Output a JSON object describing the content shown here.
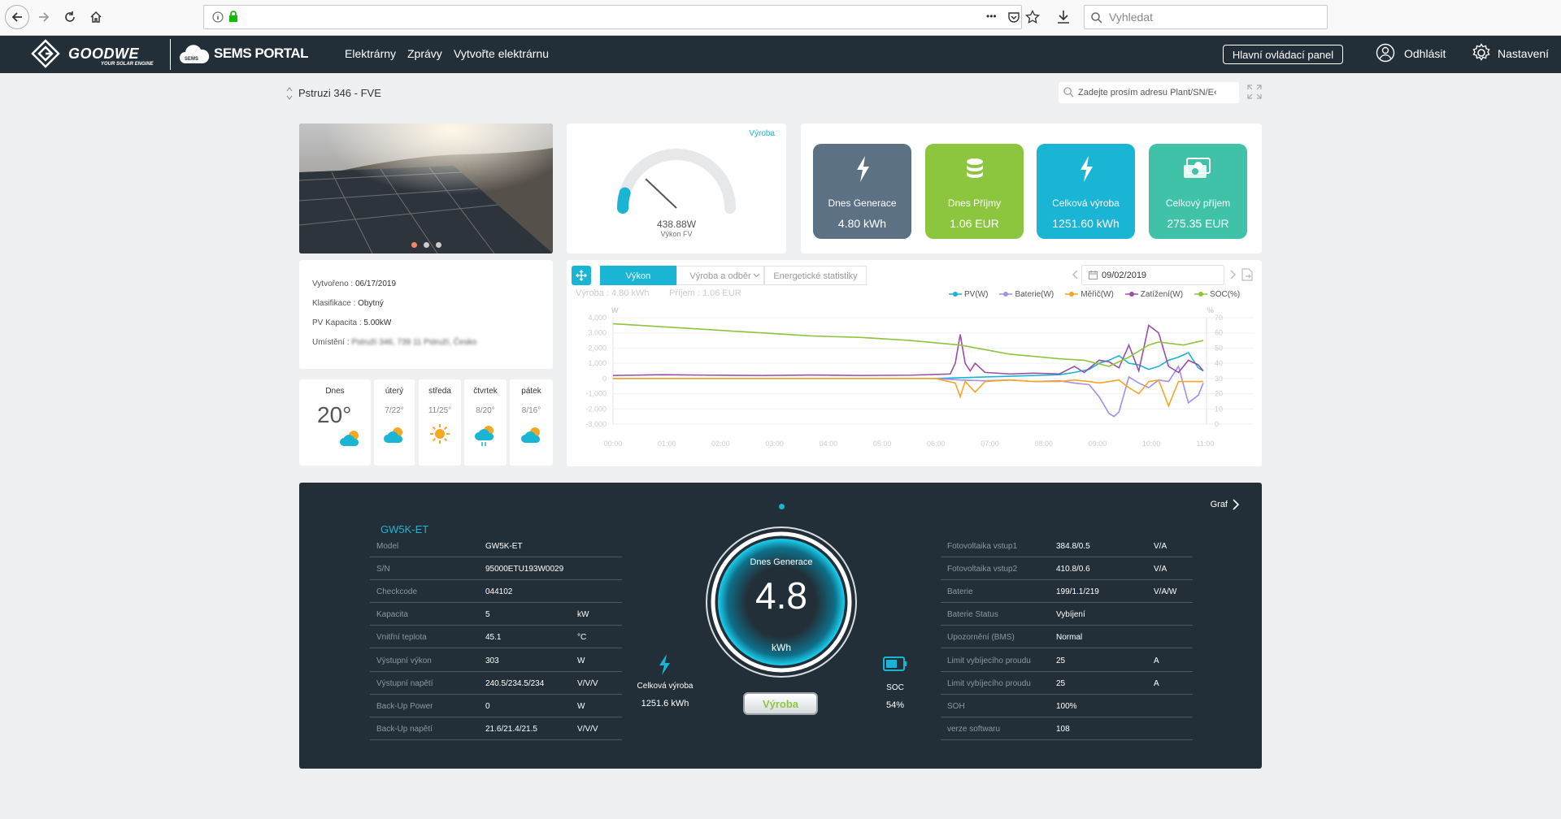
{
  "browser": {
    "search_placeholder": "Vyhledat",
    "menu_dots": "•••"
  },
  "nav": {
    "logo_main": "GOODWE",
    "logo_tagline": "YOUR SOLAR ENGINE",
    "portal_badge": "SEMS",
    "portal_name": "SEMS PORTAL",
    "links": [
      "Elektrárny",
      "Zprávy",
      "Vytvořte elektrárnu"
    ],
    "dashboard_button": "Hlavní ovládací panel",
    "logout": "Odhlásit",
    "settings": "Nastavení"
  },
  "page": {
    "plant_name": "Pstruzi 346 - FVE",
    "search_placeholder": "Zadejte prosím adresu Plant/SN/E‹"
  },
  "gauge": {
    "tag": "Výroba",
    "value": "438.88W",
    "label": "Výkon FV",
    "fraction": 0.09
  },
  "tiles": [
    {
      "label": "Dnes Generace",
      "value": "4.80 kWh",
      "color": "#5c7184",
      "icon": "lightning-icon"
    },
    {
      "label": "Dnes Příjmy",
      "value": "1.06 EUR",
      "color": "#8cc63f",
      "icon": "coins-icon"
    },
    {
      "label": "Celková výroba",
      "value": "1251.60 kWh",
      "color": "#1ab4d4",
      "icon": "lightning-icon"
    },
    {
      "label": "Celkový příjem",
      "value": "275.35 EUR",
      "color": "#3fc2a8",
      "icon": "money-icon"
    }
  ],
  "plant_info": [
    {
      "key": "Vytvořeno : ",
      "value": "06/17/2019"
    },
    {
      "key": "Klasifikace : ",
      "value": "Obytný"
    },
    {
      "key": "PV Kapacita : ",
      "value": "5.00kW"
    },
    {
      "key": "Umístění : ",
      "value": "Pstruží 346, 739 11 Pstruží, Česko"
    }
  ],
  "weather": [
    {
      "day": "Dnes",
      "temp": "20°",
      "icon": "partly-cloudy-icon"
    },
    {
      "day": "úterý",
      "temp": "7/22°",
      "icon": "partly-cloudy-icon"
    },
    {
      "day": "středa",
      "temp": "11/25°",
      "icon": "sun-icon"
    },
    {
      "day": "čtvrtek",
      "temp": "8/20°",
      "icon": "rain-icon"
    },
    {
      "day": "pátek",
      "temp": "8/16°",
      "icon": "partly-cloudy-icon"
    }
  ],
  "chart_tabs": [
    "Výkon",
    "Výroba a odběr",
    "Energetické statistiky"
  ],
  "chart_summary": {
    "production": "Výroba : 4.80 kWh",
    "income": "Příjem : 1.06 EUR"
  },
  "chart_date": "09/02/2019",
  "chart_data": {
    "type": "line",
    "xlabel": "",
    "ylabel": "W",
    "y2label": "%",
    "x": [
      "00:00",
      "01:00",
      "02:00",
      "03:00",
      "04:00",
      "05:00",
      "06:00",
      "07:00",
      "08:00",
      "09:00",
      "10:00",
      "11:00"
    ],
    "ylim": [
      -3000,
      4000
    ],
    "yticks": [
      "4,000",
      "3,000",
      "2,000",
      "1,000",
      "0",
      "-1,000",
      "-2,000",
      "-3,000"
    ],
    "y2lim": [
      0,
      70
    ],
    "y2ticks": [
      "70",
      "60",
      "50",
      "40",
      "30",
      "20",
      "10",
      "0"
    ],
    "legend_position": "top-right",
    "series": [
      {
        "name": "PV(W)",
        "color": "#1ab4d4",
        "axis": "left",
        "points": [
          [
            0,
            0
          ],
          [
            6.5,
            0
          ],
          [
            7,
            50
          ],
          [
            7.5,
            100
          ],
          [
            8,
            150
          ],
          [
            8.5,
            200
          ],
          [
            9,
            250
          ],
          [
            9.3,
            400
          ],
          [
            9.6,
            600
          ],
          [
            9.8,
            1000
          ],
          [
            10,
            1200
          ],
          [
            10.2,
            1500
          ],
          [
            10.4,
            1000
          ],
          [
            10.6,
            900
          ],
          [
            10.8,
            600
          ],
          [
            11,
            800
          ],
          [
            11.2,
            1200
          ],
          [
            11.4,
            1400
          ],
          [
            11.6,
            1700
          ],
          [
            11.8,
            700
          ],
          [
            11.9,
            500
          ]
        ]
      },
      {
        "name": "Baterie(W)",
        "color": "#a58ee8",
        "axis": "left",
        "points": [
          [
            0,
            0
          ],
          [
            6.5,
            0
          ],
          [
            7,
            -100
          ],
          [
            7.5,
            -150
          ],
          [
            8,
            -100
          ],
          [
            8.5,
            -200
          ],
          [
            9,
            -150
          ],
          [
            9.3,
            -300
          ],
          [
            9.6,
            -400
          ],
          [
            9.8,
            -1200
          ],
          [
            10,
            -2300
          ],
          [
            10.1,
            -2500
          ],
          [
            10.2,
            -2200
          ],
          [
            10.4,
            100
          ],
          [
            10.6,
            -300
          ],
          [
            10.8,
            -600
          ],
          [
            11,
            -100
          ],
          [
            11.2,
            -200
          ],
          [
            11.4,
            800
          ],
          [
            11.6,
            -1600
          ],
          [
            11.8,
            -1100
          ],
          [
            11.9,
            -300
          ]
        ]
      },
      {
        "name": "Měřič(W)",
        "color": "#f5a623",
        "axis": "left",
        "points": [
          [
            0,
            0
          ],
          [
            6.5,
            0
          ],
          [
            6.9,
            -300
          ],
          [
            7,
            -1200
          ],
          [
            7.1,
            -200
          ],
          [
            7.3,
            -900
          ],
          [
            7.5,
            -200
          ],
          [
            8,
            -100
          ],
          [
            8.5,
            -200
          ],
          [
            9,
            -200
          ],
          [
            9.3,
            -100
          ],
          [
            9.6,
            -200
          ],
          [
            9.8,
            -300
          ],
          [
            10,
            -200
          ],
          [
            10.2,
            -100
          ],
          [
            10.4,
            -600
          ],
          [
            10.6,
            -1000
          ],
          [
            10.8,
            -200
          ],
          [
            11,
            -100
          ],
          [
            11.2,
            -1800
          ],
          [
            11.4,
            -200
          ],
          [
            11.9,
            -200
          ]
        ]
      },
      {
        "name": "Zatížení(W)",
        "color": "#9a4ea6",
        "axis": "left",
        "points": [
          [
            0,
            200
          ],
          [
            1,
            250
          ],
          [
            2,
            220
          ],
          [
            3,
            200
          ],
          [
            4,
            230
          ],
          [
            5,
            200
          ],
          [
            6,
            220
          ],
          [
            6.8,
            300
          ],
          [
            6.9,
            1000
          ],
          [
            7,
            2900
          ],
          [
            7.1,
            1000
          ],
          [
            7.2,
            500
          ],
          [
            7.3,
            1000
          ],
          [
            7.5,
            400
          ],
          [
            8,
            300
          ],
          [
            8.5,
            350
          ],
          [
            9,
            300
          ],
          [
            9.3,
            800
          ],
          [
            9.5,
            400
          ],
          [
            9.8,
            1200
          ],
          [
            10,
            1100
          ],
          [
            10.2,
            700
          ],
          [
            10.4,
            2200
          ],
          [
            10.6,
            500
          ],
          [
            10.8,
            3500
          ],
          [
            11,
            3000
          ],
          [
            11.2,
            800
          ],
          [
            11.4,
            400
          ],
          [
            11.6,
            1200
          ],
          [
            11.8,
            900
          ],
          [
            11.9,
            500
          ]
        ]
      },
      {
        "name": "SOC(%)",
        "color": "#8cc63f",
        "axis": "right",
        "points": [
          [
            0,
            66
          ],
          [
            1,
            64
          ],
          [
            2,
            62
          ],
          [
            3,
            60
          ],
          [
            4,
            58
          ],
          [
            5,
            57
          ],
          [
            6,
            55
          ],
          [
            7,
            52
          ],
          [
            8,
            46
          ],
          [
            9,
            43
          ],
          [
            9.5,
            42
          ],
          [
            10,
            38
          ],
          [
            10.4,
            44
          ],
          [
            10.6,
            48
          ],
          [
            10.8,
            52
          ],
          [
            11,
            54
          ],
          [
            11.5,
            52
          ],
          [
            11.9,
            55
          ]
        ]
      }
    ]
  },
  "inverter": {
    "title": "GW5K-ET",
    "left_rows": [
      {
        "key": "Model",
        "value": "GW5K-ET",
        "unit": ""
      },
      {
        "key": "S/N",
        "value": "95000ETU193W0029",
        "unit": ""
      },
      {
        "key": "Checkcode",
        "value": "044102",
        "unit": ""
      },
      {
        "key": "Kapacita",
        "value": "5",
        "unit": "kW"
      },
      {
        "key": "Vnitřní teplota",
        "value": "45.1",
        "unit": "°C"
      },
      {
        "key": "Výstupní výkon",
        "value": "303",
        "unit": "W"
      },
      {
        "key": "Výstupní napětí",
        "value": "240.5/234.5/234",
        "unit": "V/V/V"
      },
      {
        "key": "Back-Up Power",
        "value": "0",
        "unit": "W"
      },
      {
        "key": "Back-Up napětí",
        "value": "21.6/21.4/21.5",
        "unit": "V/V/V"
      }
    ],
    "right_rows": [
      {
        "key": "Fotovoltaika vstup1",
        "value": "384.8/0.5",
        "unit": "V/A"
      },
      {
        "key": "Fotovoltaika vstup2",
        "value": "410.8/0.6",
        "unit": "V/A"
      },
      {
        "key": "Baterie",
        "value": "199/1.1/219",
        "unit": "V/A/W"
      },
      {
        "key": "Baterie Status",
        "value": "Vybíjení",
        "unit": ""
      },
      {
        "key": "Upozornění (BMS)",
        "value": "Normal",
        "unit": ""
      },
      {
        "key": "Limit vybíjecího proudu",
        "value": "25",
        "unit": "A"
      },
      {
        "key": "Limit vybíjecího proudu",
        "value": "25",
        "unit": "A"
      },
      {
        "key": "SOH",
        "value": "100%",
        "unit": ""
      },
      {
        "key": "verze softwaru",
        "value": "108",
        "unit": ""
      }
    ],
    "center_label": "Dnes Generace",
    "center_value": "4.8",
    "center_unit": "kWh",
    "total_label": "Celková výroba",
    "total_value": "1251.6 kWh",
    "soc_label": "SOC",
    "soc_value": "54%",
    "production_button": "Výroba",
    "graph_link": "Graf"
  }
}
